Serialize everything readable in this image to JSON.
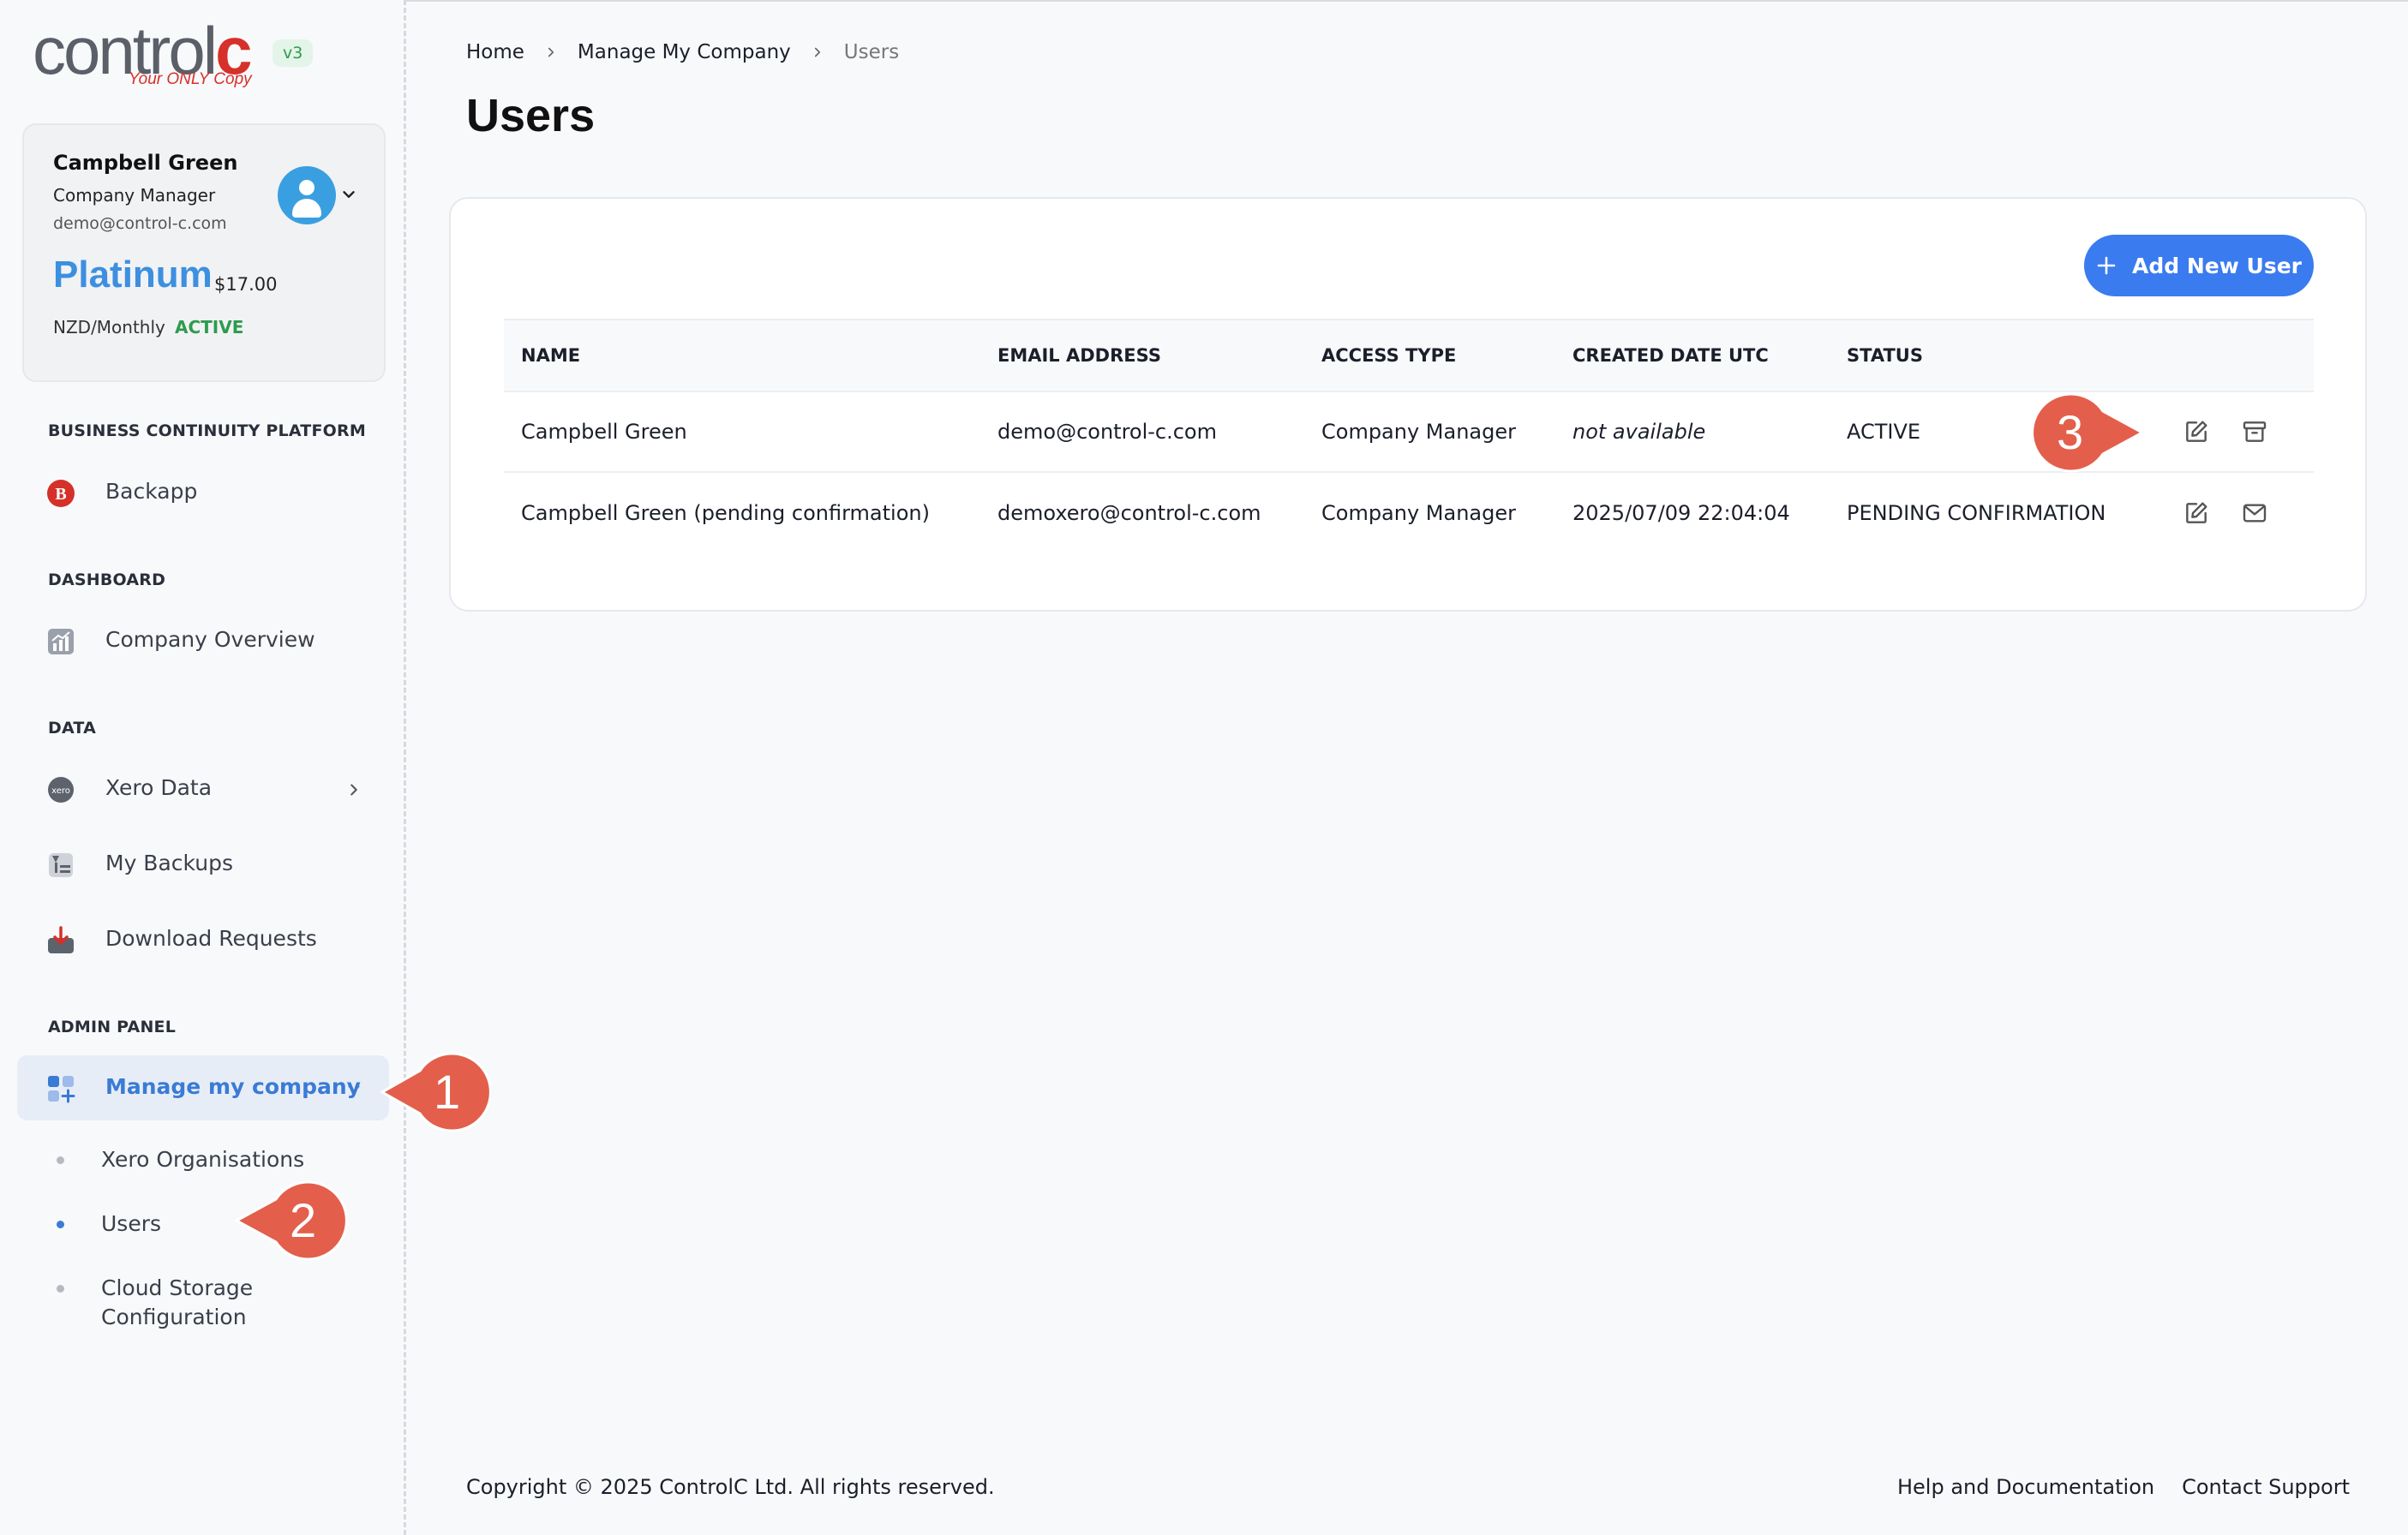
{
  "logo": {
    "wordmark_main": "control",
    "wordmark_accent": "c",
    "tagline": "Your ONLY Copy",
    "version": "v3"
  },
  "user_card": {
    "name": "Campbell Green",
    "role": "Company Manager",
    "email": "demo@control-c.com",
    "plan": "Platinum",
    "price": "$17.00",
    "period": "NZD/Monthly",
    "status": "ACTIVE"
  },
  "sidebar": {
    "sections": {
      "platform": "BUSINESS CONTINUITY PLATFORM",
      "dashboard": "DASHBOARD",
      "data": "DATA",
      "admin": "ADMIN PANEL"
    },
    "items": {
      "backapp": "Backapp",
      "company_overview": "Company Overview",
      "xero_data": "Xero Data",
      "my_backups": "My Backups",
      "download_requests": "Download Requests",
      "manage_company": "Manage my company"
    },
    "sub_items": {
      "xero_orgs": "Xero Organisations",
      "users": "Users",
      "cloud_storage": "Cloud Storage Configuration"
    }
  },
  "breadcrumb": {
    "home": "Home",
    "manage": "Manage My Company",
    "current": "Users"
  },
  "page_title": "Users",
  "add_button": "Add New User",
  "table": {
    "headers": {
      "name": "NAME",
      "email": "EMAIL ADDRESS",
      "access": "ACCESS TYPE",
      "created": "CREATED DATE UTC",
      "status": "STATUS"
    },
    "rows": [
      {
        "name": "Campbell Green",
        "email": "demo@control-c.com",
        "access": "Company Manager",
        "created": "not available",
        "status": "ACTIVE"
      },
      {
        "name": "Campbell Green (pending confirmation)",
        "email": "demoxero@control-c.com",
        "access": "Company Manager",
        "created": "2025/07/09 22:04:04",
        "status": "PENDING CONFIRMATION"
      }
    ]
  },
  "callouts": {
    "one": "1",
    "two": "2",
    "three": "3"
  },
  "footer": {
    "copyright": "Copyright © 2025 ControlC Ltd. All rights reserved.",
    "help": "Help and Documentation",
    "support": "Contact Support"
  },
  "colors": {
    "accent": "#3a7bf0",
    "brand_red": "#d6302a",
    "active_green": "#2e9b4e",
    "pending_orange": "#e08a14",
    "callout": "#e35f4b"
  }
}
